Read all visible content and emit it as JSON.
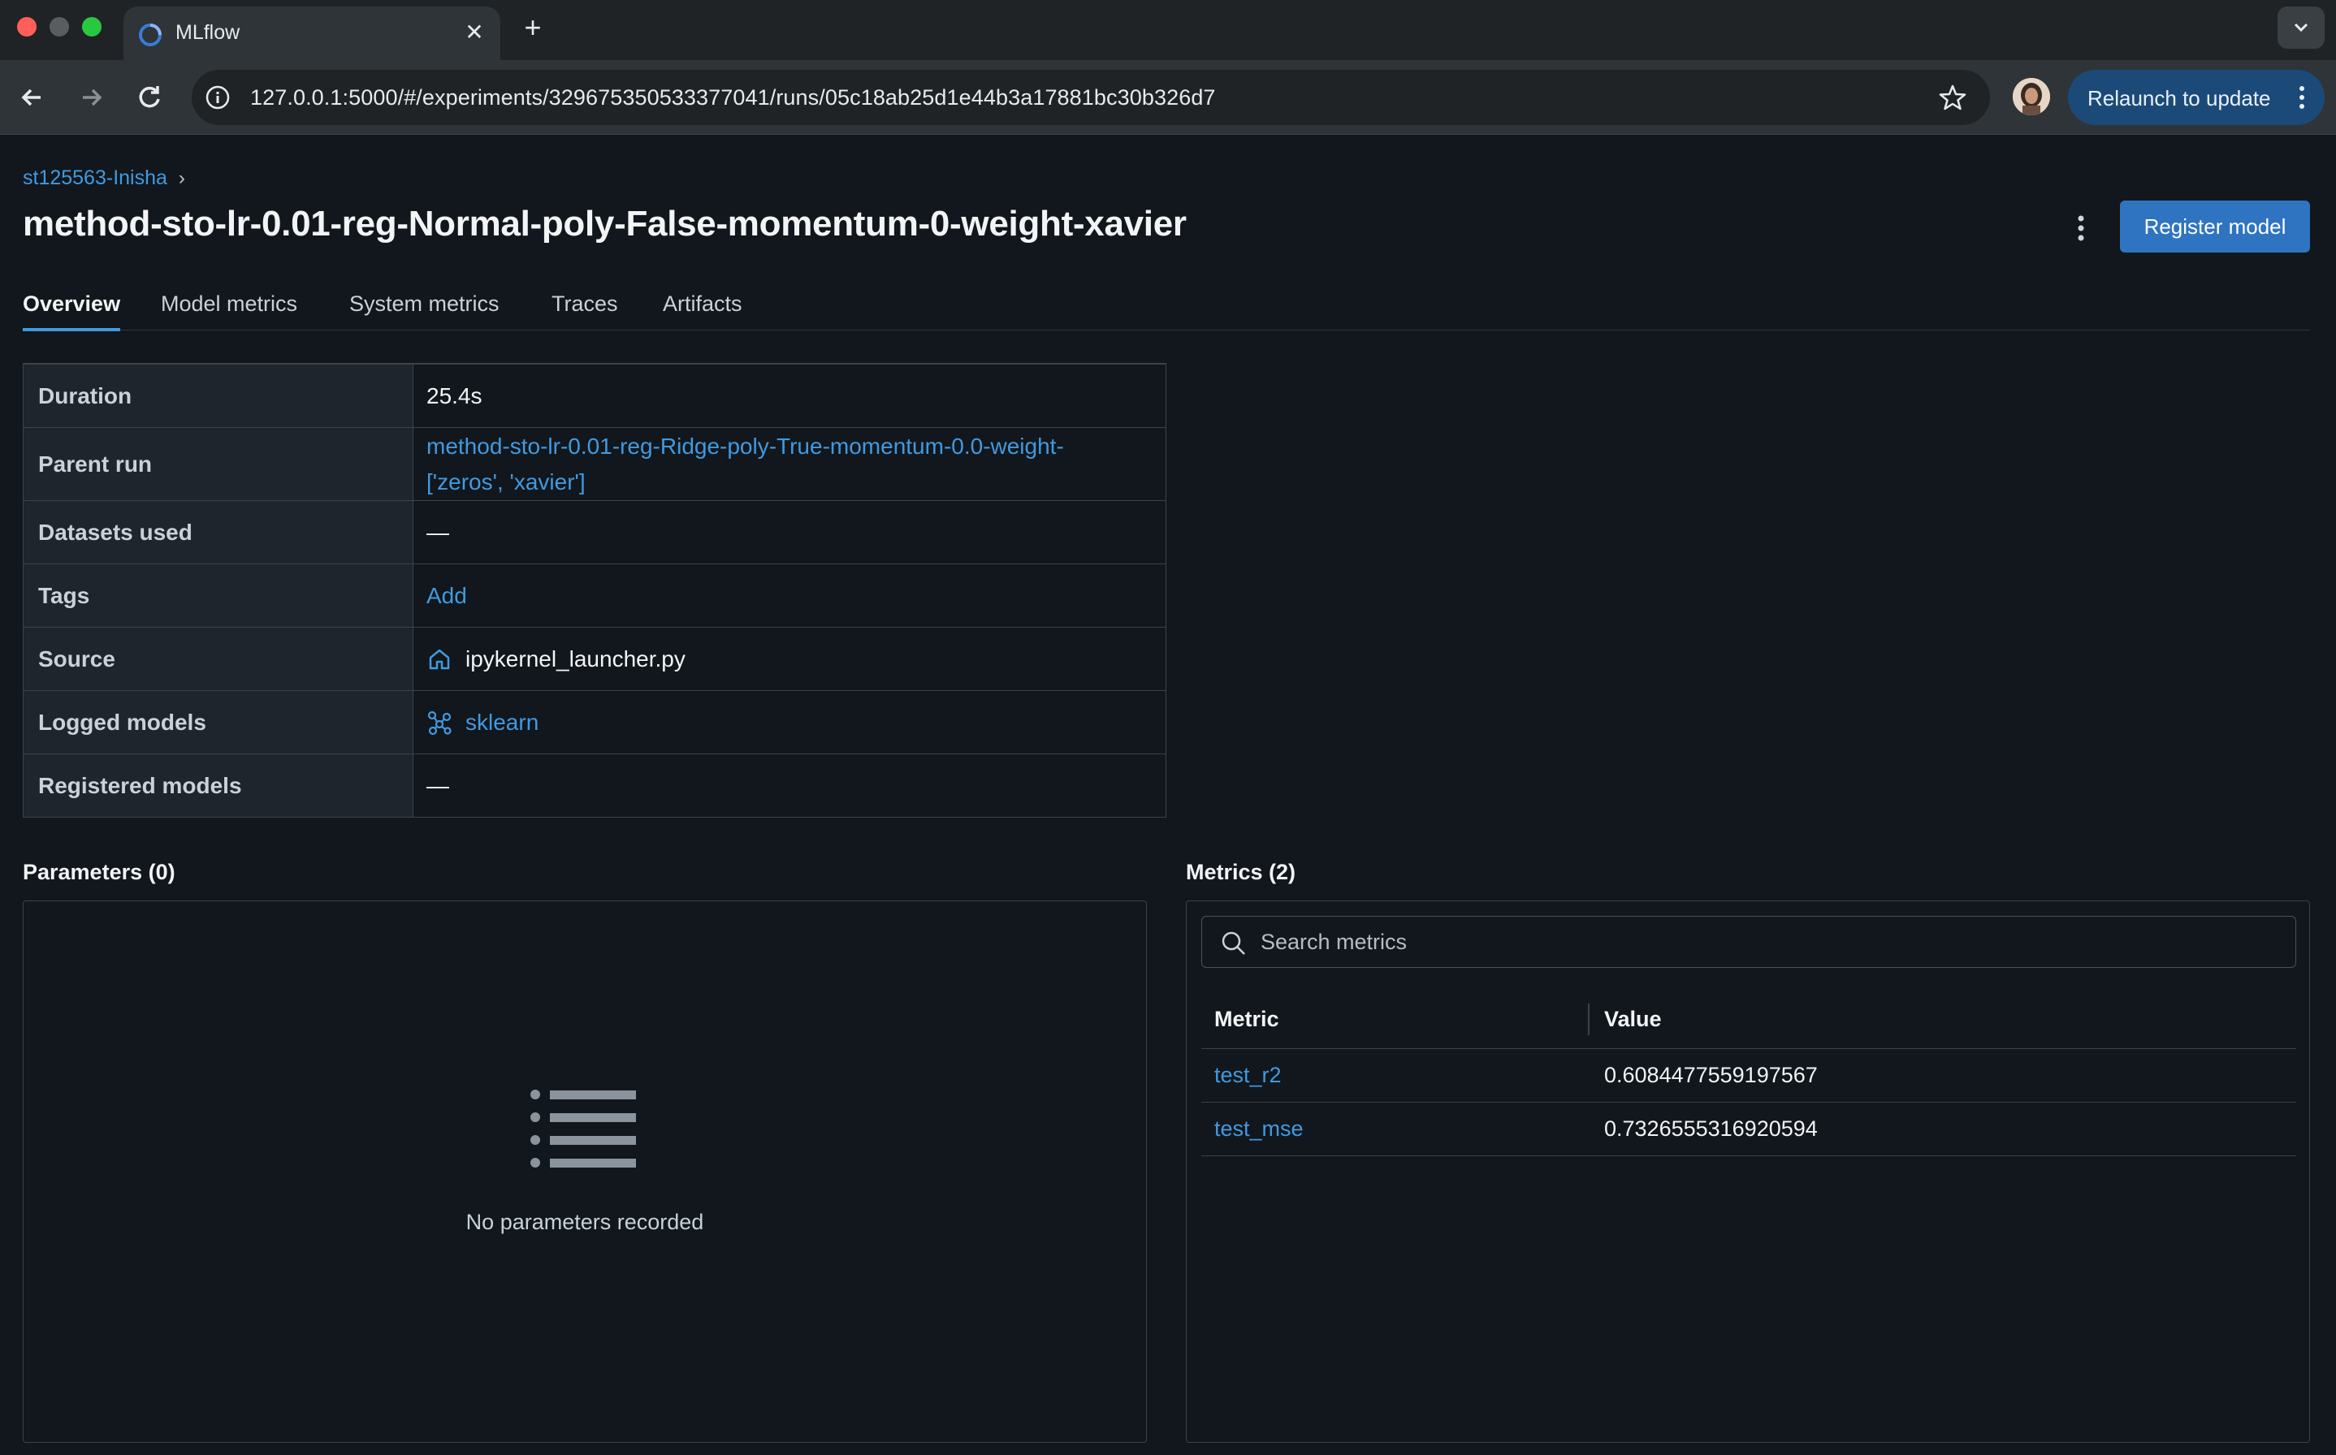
{
  "browser": {
    "tab_title": "MLflow",
    "url": "127.0.0.1:5000/#/experiments/329675350533377041/runs/05c18ab25d1e44b3a17881bc30b326d7",
    "relaunch_label": "Relaunch to update"
  },
  "breadcrumb": {
    "experiment": "st125563-Inisha"
  },
  "run": {
    "title": "method-sto-lr-0.01-reg-Normal-poly-False-momentum-0-weight-xavier",
    "register_label": "Register model"
  },
  "tabs": [
    "Overview",
    "Model metrics",
    "System metrics",
    "Traces",
    "Artifacts"
  ],
  "details": {
    "duration_label": "Duration",
    "duration_value": "25.4s",
    "parent_label": "Parent run",
    "parent_value_line1": "method-sto-lr-0.01-reg-Ridge-poly-True-momentum-0.0-weight-",
    "parent_value_line2": "['zeros', 'xavier']",
    "datasets_label": "Datasets used",
    "datasets_value": "—",
    "tags_label": "Tags",
    "tags_value": "Add",
    "source_label": "Source",
    "source_value": "ipykernel_launcher.py",
    "logged_label": "Logged models",
    "logged_value": "sklearn",
    "registered_label": "Registered models",
    "registered_value": "—"
  },
  "parameters": {
    "title": "Parameters (0)",
    "empty_text": "No parameters recorded"
  },
  "metrics": {
    "title": "Metrics (2)",
    "search_placeholder": "Search metrics",
    "col_metric": "Metric",
    "col_value": "Value",
    "rows": [
      {
        "name": "test_r2",
        "value": "0.6084477559197567"
      },
      {
        "name": "test_mse",
        "value": "0.7326555316920594"
      }
    ]
  },
  "colors": {
    "accent": "#4299e0",
    "primary_button": "#2e74c0",
    "background": "#11171c"
  }
}
